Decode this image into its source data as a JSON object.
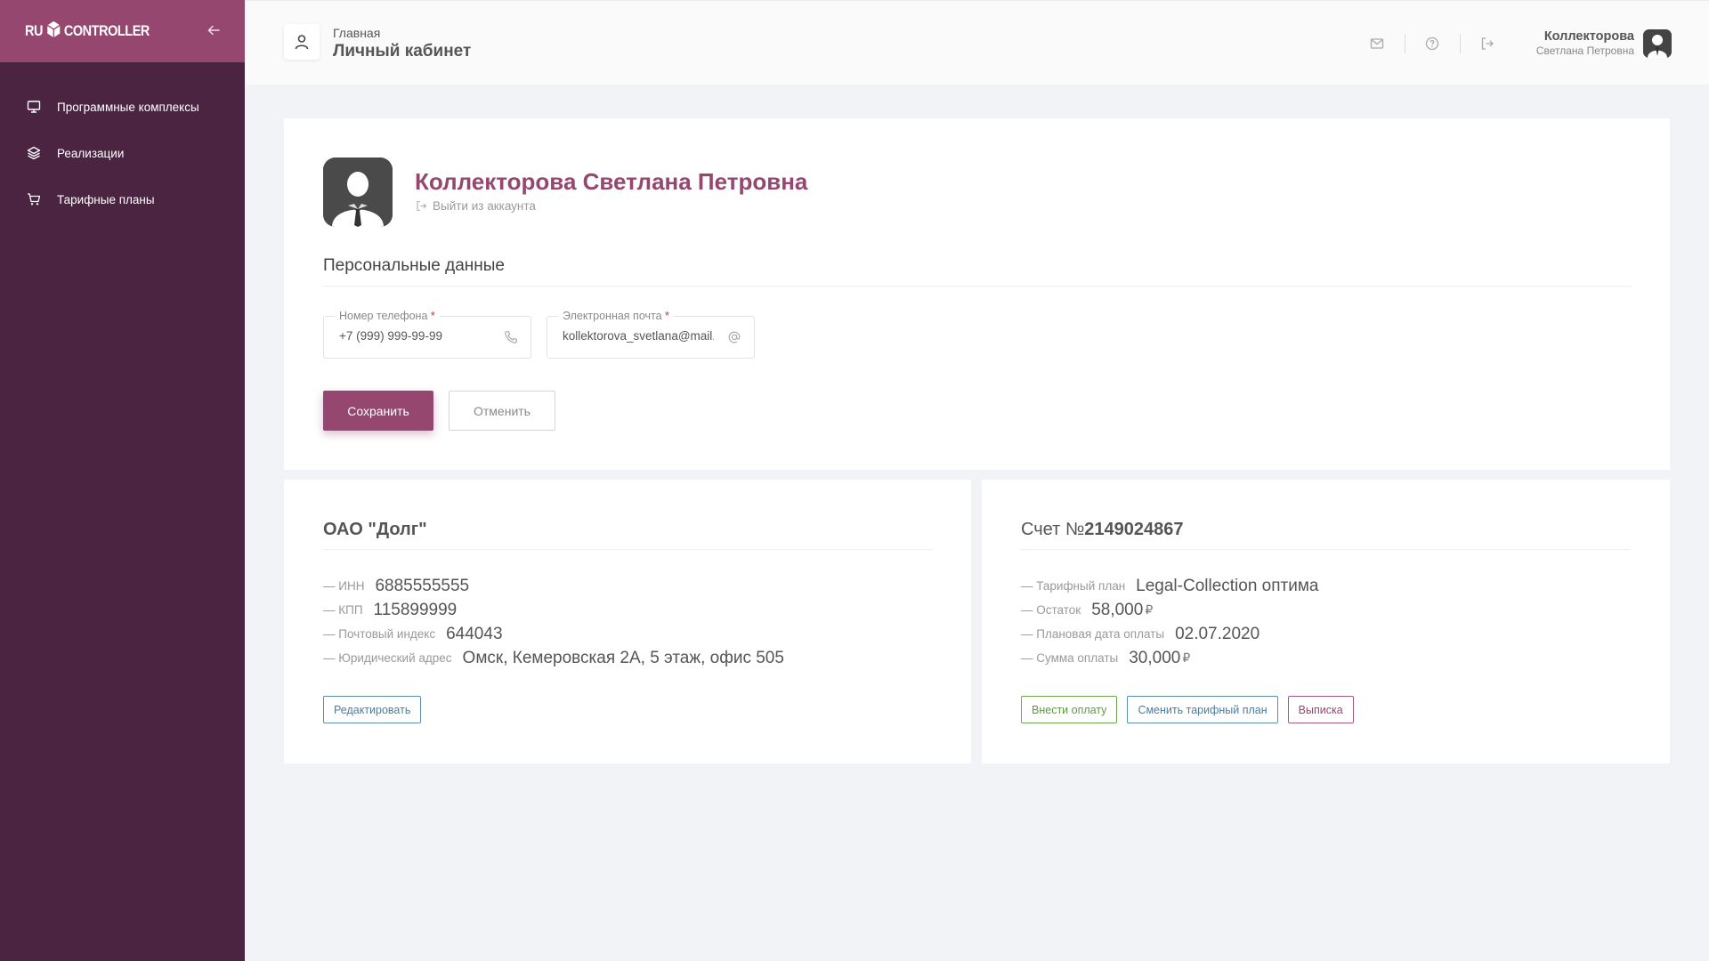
{
  "brand": {
    "logo_left": "RU",
    "logo_right": "CONTROLLER",
    "primary_color": "#96476f",
    "sidebar_color": "#4a2440"
  },
  "sidebar": {
    "collapse_icon": "arrow-left-icon",
    "items": [
      {
        "label": "Программные комплексы",
        "icon": "monitor-icon"
      },
      {
        "label": "Реализации",
        "icon": "layers-icon"
      },
      {
        "label": "Тарифные планы",
        "icon": "cart-icon"
      }
    ]
  },
  "header": {
    "breadcrumb_small": "Главная",
    "breadcrumb_title": "Личный кабинет",
    "icons": [
      "mail-icon",
      "help-icon",
      "logout-icon"
    ],
    "user_last_name": "Коллекторова",
    "user_first_names": "Светлана Петровна"
  },
  "profile": {
    "full_name": "Коллекторова Светлана Петровна",
    "logout_label": "Выйти из аккаунта",
    "section_title": "Персональные данные",
    "phone_label": "Номер телефона",
    "phone_value": "+7 (999) 999-99-99",
    "email_label": "Электронная почта",
    "email_value": "kollektorova_svetlana@mail.ru",
    "required_mark": "*",
    "save_label": "Сохранить",
    "cancel_label": "Отменить"
  },
  "organization": {
    "title": "ОАО \"Долг\"",
    "fields": [
      {
        "key": "— ИНН",
        "value": "6885555555"
      },
      {
        "key": "— КПП",
        "value": "115899999"
      },
      {
        "key": "— Почтовый индекс",
        "value": "644043"
      },
      {
        "key": "— Юридический адрес",
        "value": "Омск, Кемеровская 2А, 5 этаж, офис 505"
      }
    ],
    "edit_label": "Редактировать"
  },
  "account": {
    "title_prefix": "Счет №",
    "number": "2149024867",
    "currency": "₽",
    "fields": [
      {
        "key": "— Тарифный план",
        "value": "Legal-Collection оптима"
      },
      {
        "key": "— Остаток",
        "value": "58,000"
      },
      {
        "key": "— Плановая дата оплаты",
        "value": "02.07.2020"
      },
      {
        "key": "— Сумма оплаты",
        "value": "30,000"
      }
    ],
    "pay_label": "Внести оплату",
    "change_plan_label": "Сменить тарифный план",
    "statement_label": "Выписка"
  }
}
